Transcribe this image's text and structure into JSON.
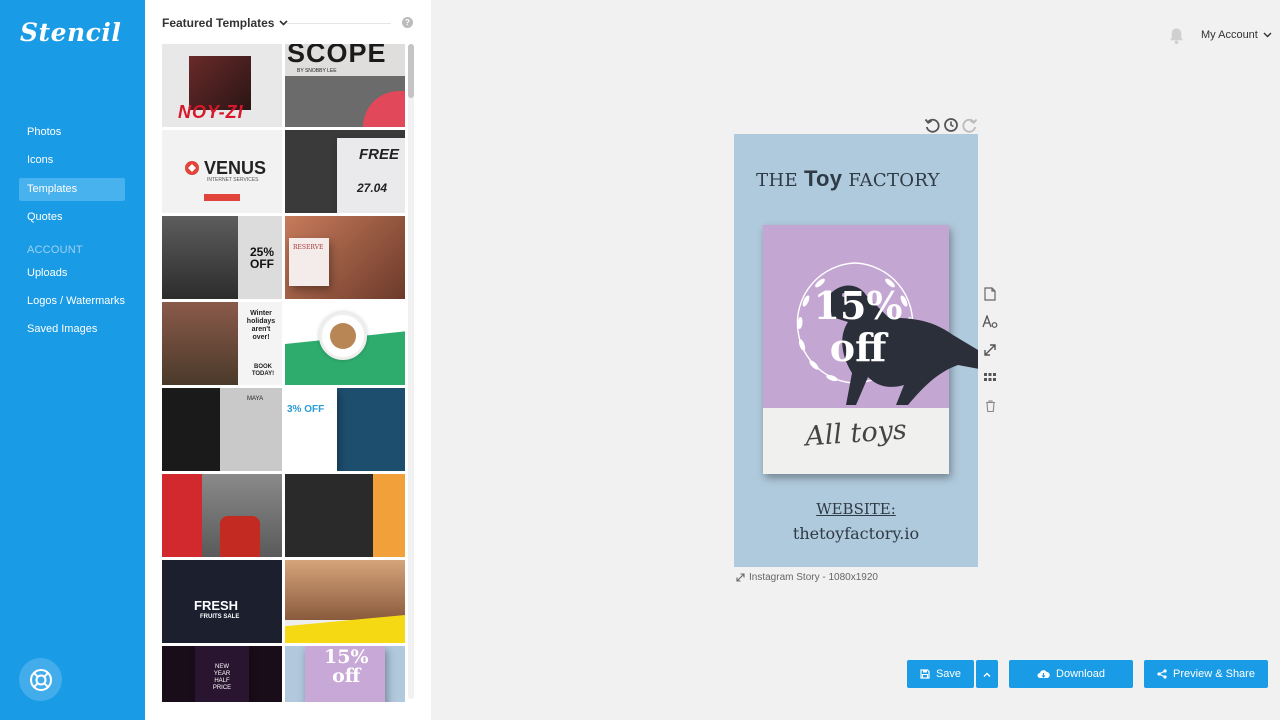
{
  "app": {
    "logo": "Stencil"
  },
  "sidebar": {
    "items": [
      {
        "label": "Photos"
      },
      {
        "label": "Icons"
      },
      {
        "label": "Templates"
      },
      {
        "label": "Quotes"
      }
    ],
    "section_label": "ACCOUNT",
    "account_items": [
      {
        "label": "Uploads"
      },
      {
        "label": "Logos / Watermarks"
      },
      {
        "label": "Saved Images"
      }
    ],
    "help_icon": "lifebuoy-icon"
  },
  "panel": {
    "title": "Featured Templates",
    "help": "?",
    "tiles": [
      {
        "title": "NOY-ZI",
        "small": ""
      },
      {
        "title": "SCOPE",
        "small": "BY SNOBBY LEE"
      },
      {
        "title": "VENUS",
        "small": "INTERNET SERVICES"
      },
      {
        "title": "FREE",
        "small": "27.04"
      },
      {
        "title": "25%",
        "small": "OFF"
      },
      {
        "title": "RESERVE",
        "small": ""
      },
      {
        "title": "Winter holidays aren't over!",
        "small": "BOOK TODAY!"
      },
      {
        "title": "",
        "small": ""
      },
      {
        "title": "MAYA",
        "small": ""
      },
      {
        "title": "3% OFF",
        "small": ""
      },
      {
        "title": "",
        "small": ""
      },
      {
        "title": "",
        "small": ""
      },
      {
        "title": "FRESH",
        "small": "FRUITS SALE"
      },
      {
        "title": "",
        "small": ""
      },
      {
        "title": "NEW YEAR",
        "small": "HALF PRICE"
      },
      {
        "title": "15%",
        "small": "off"
      }
    ]
  },
  "header": {
    "account_label": "My Account"
  },
  "design": {
    "brand_pre": "THE",
    "brand_mid": "Toy",
    "brand_post": "FACTORY",
    "offer_line1": "15%",
    "offer_line2": "off",
    "script": "All toys",
    "website_label": "WEBSITE:",
    "url": "thetoyfactory.io",
    "size_label": "Instagram Story - 1080x1920"
  },
  "buttons": {
    "save": "Save",
    "download": "Download",
    "preview": "Preview & Share"
  },
  "colors": {
    "accent": "#1a9be5",
    "canvas_bg": "#b0cadd",
    "card_purple": "#c4a6d2"
  }
}
